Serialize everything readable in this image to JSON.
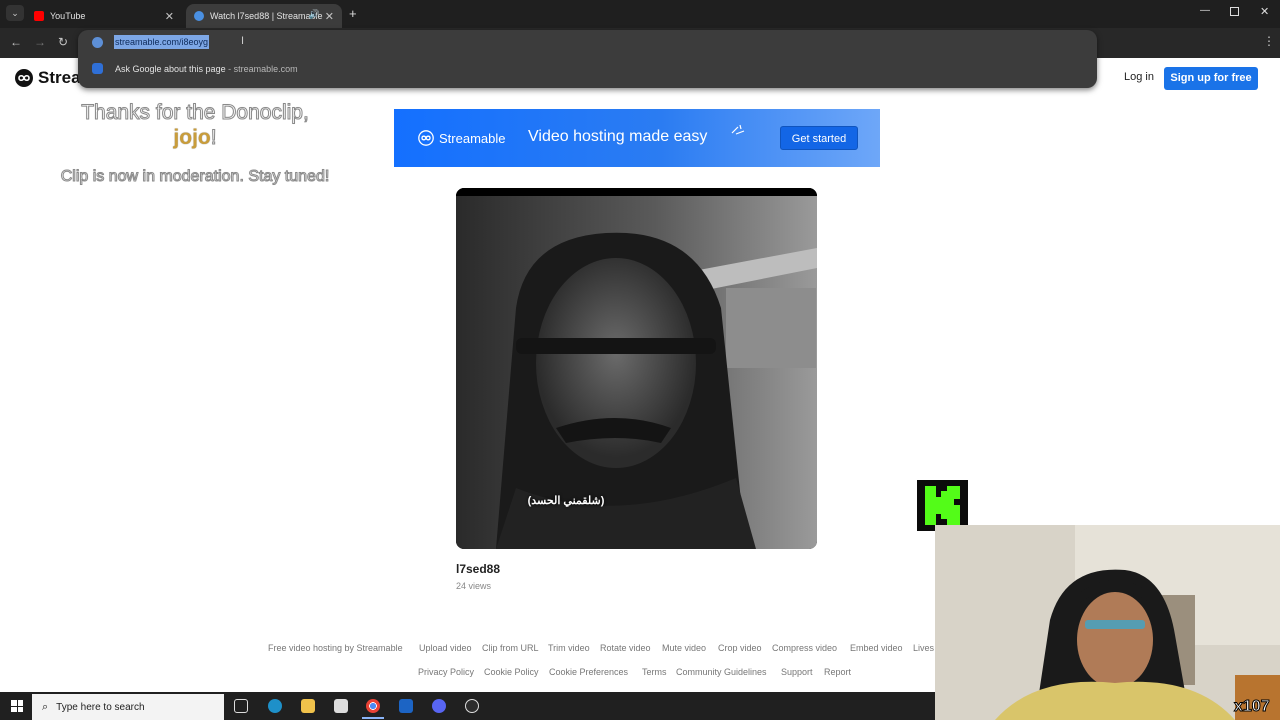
{
  "browser": {
    "tabs": [
      {
        "label": "YouTube",
        "favicon_color": "#ff0000"
      },
      {
        "label": "Watch l7sed88 | Streamable",
        "favicon_color": "#4a90e2"
      }
    ],
    "url": "streamable.com/i8eoyg",
    "suggestion": {
      "label": "Ask Google about this page",
      "separator": " - ",
      "domain": "streamable.com"
    }
  },
  "site": {
    "brand": "Streamable",
    "login_label": "Log in",
    "signup_label": "Sign up for free"
  },
  "overlay": {
    "thanks_line": "Thanks for the Donoclip,",
    "donor_name": "jojo",
    "donor_suffix": "!",
    "moderation": "Clip is now in moderation. Stay tuned!"
  },
  "banner": {
    "brand": "Streamable",
    "tagline": "Video hosting made easy",
    "cta": "Get started"
  },
  "video": {
    "subtitle": "(شلقمني الحسد)",
    "title": "l7sed88",
    "views": "24 views"
  },
  "footer": {
    "row1": [
      "Free video hosting by Streamable",
      "Upload video",
      "Clip from URL",
      "Trim video",
      "Rotate video",
      "Mute video",
      "Crop video",
      "Compress video",
      "Embed video",
      "Lives"
    ],
    "row2": [
      "Privacy Policy",
      "Cookie Policy",
      "Cookie Preferences",
      "Terms",
      "Community Guidelines",
      "Support",
      "Report"
    ]
  },
  "stream": {
    "counter": "x107"
  },
  "taskbar": {
    "search_placeholder": "Type here to search"
  },
  "colors": {
    "accent": "#1a73e8",
    "chrome_bg": "#1f1f1f",
    "donor_gold": "#c99d3b",
    "kick_green": "#53fc18"
  }
}
